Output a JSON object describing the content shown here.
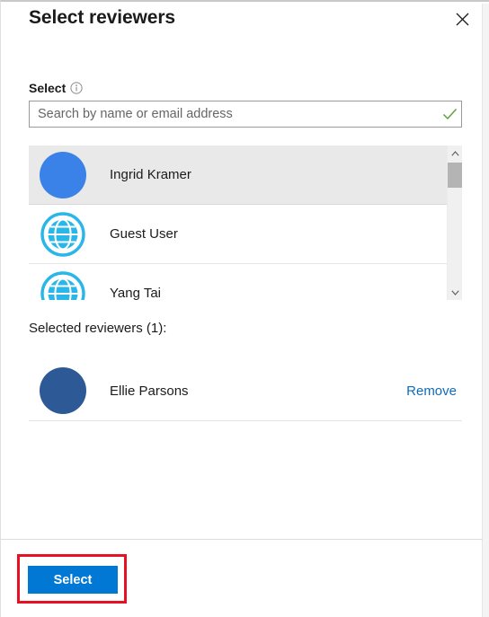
{
  "dialog": {
    "title": "Select reviewers",
    "close_icon": "close-icon"
  },
  "field": {
    "label": "Select",
    "info_icon": "info-icon"
  },
  "search": {
    "value": "",
    "placeholder": "Search by name or email address",
    "validation_icon": "checkmark-icon",
    "validation_color": "#5d9c2e"
  },
  "results": {
    "items": [
      {
        "name": "Ingrid Kramer",
        "avatar_type": "photo",
        "avatar_color": "#3b82e8",
        "selected": true
      },
      {
        "name": "Guest User",
        "avatar_type": "globe",
        "avatar_color": "#29b6e8",
        "selected": false
      },
      {
        "name": "Yang Tai",
        "avatar_type": "globe",
        "avatar_color": "#29b6e8",
        "selected": false
      }
    ],
    "scrollbar": {
      "up_icon": "chevron-up-icon",
      "down_icon": "chevron-down-icon"
    }
  },
  "selected": {
    "heading": "Selected reviewers (1):",
    "items": [
      {
        "name": "Ellie Parsons",
        "avatar_color": "#2d5a96",
        "remove_label": "Remove"
      }
    ]
  },
  "footer": {
    "select_label": "Select",
    "accent_color": "#0078d4",
    "highlight_color": "#e81123"
  }
}
